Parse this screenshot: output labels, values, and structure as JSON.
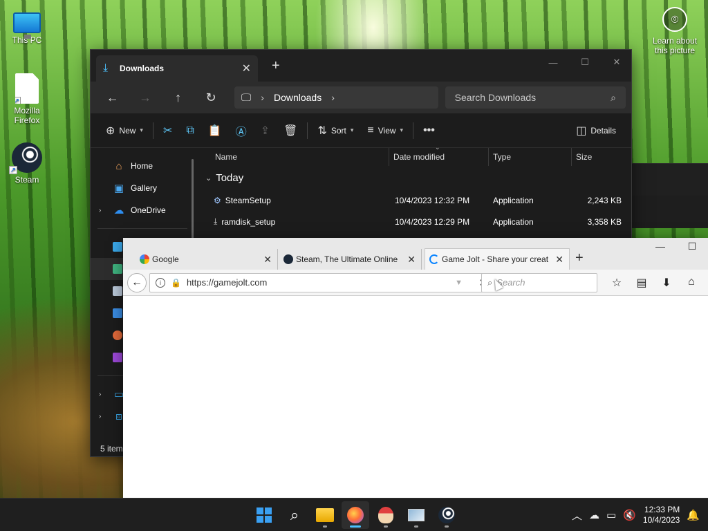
{
  "desktop": {
    "icons": [
      {
        "label": "This PC"
      },
      {
        "label": "Mozilla\nFirefox"
      },
      {
        "label": "Steam"
      }
    ],
    "learn_label": "Learn about this picture"
  },
  "explorer": {
    "tab_title": "Downloads",
    "breadcrumb": "Downloads",
    "search_placeholder": "Search Downloads",
    "commands": {
      "new": "New",
      "sort": "Sort",
      "view": "View",
      "details": "Details"
    },
    "nav": {
      "home": "Home",
      "gallery": "Gallery",
      "onedrive": "OneDrive"
    },
    "columns": {
      "name": "Name",
      "date": "Date modified",
      "type": "Type",
      "size": "Size"
    },
    "group": "Today",
    "files": [
      {
        "name": "SteamSetup",
        "date": "10/4/2023 12:32 PM",
        "type": "Application",
        "size": "2,243 KB"
      },
      {
        "name": "ramdisk_setup",
        "date": "10/4/2023 12:29 PM",
        "type": "Application",
        "size": "3,358 KB"
      }
    ],
    "status": "5 item"
  },
  "firefox": {
    "tabs": [
      {
        "title": "Google"
      },
      {
        "title": "Steam, The Ultimate Online"
      },
      {
        "title": "Game Jolt - Share your creat"
      }
    ],
    "url": "https://gamejolt.com",
    "search_placeholder": "Search"
  },
  "taskbar": {
    "time": "12:33 PM",
    "date": "10/4/2023"
  }
}
